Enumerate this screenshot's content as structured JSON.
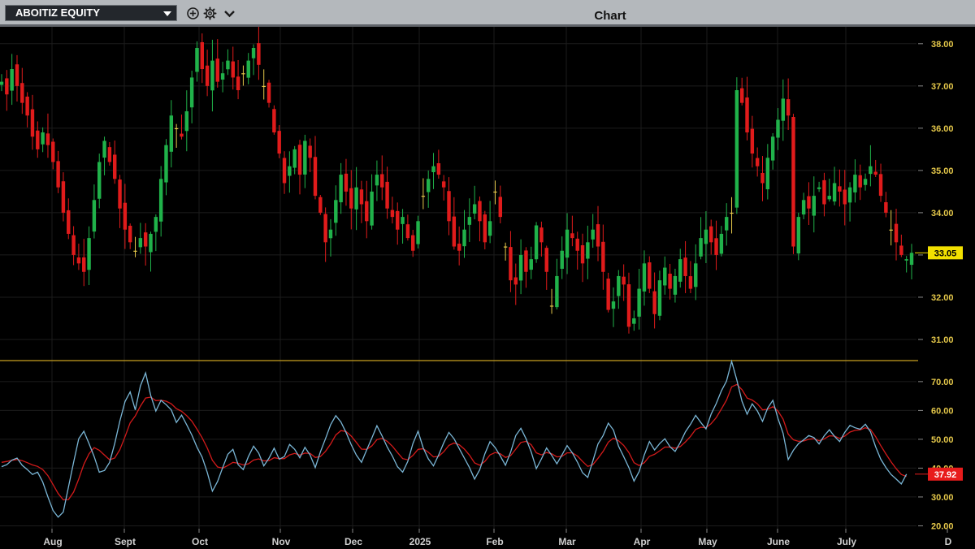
{
  "toolbar": {
    "security": "ABOITIZ EQUITY",
    "title": "Chart"
  },
  "icons": {
    "add": "add-circle-icon",
    "settings": "gear-icon",
    "dropdown": "chevron-down-icon",
    "security_dropdown": "caret-down-icon"
  },
  "colors": {
    "background": "#000000",
    "up_candle": "#20b24a",
    "down_candle": "#e01b1b",
    "doji": "#e5c84a",
    "divider": "#c8a020",
    "rsi_line": "#7ab6d6",
    "rsi_ma_line": "#d21a1a",
    "last_price_tag": "#f2e000",
    "rsi_value_tag": "#e81c1c",
    "axis_text_price": "#e5c84a",
    "axis_text_date": "#cfcfcf",
    "grid": "#1c1c1c"
  },
  "chart_data": [
    {
      "type": "candlestick",
      "title": "",
      "ylim": [
        30.5,
        38.4
      ],
      "y_ticks": [
        "38.00",
        "37.00",
        "36.00",
        "35.00",
        "34.00",
        "33.00",
        "32.00",
        "31.00"
      ],
      "x_labels": [
        "Aug",
        "Sept",
        "Oct",
        "Nov",
        "Dec",
        "2025",
        "Feb",
        "Mar",
        "Apr",
        "May",
        "June",
        "July",
        "D"
      ],
      "last_price": "33.05",
      "grid": true,
      "close": [
        37.1,
        36.8,
        37.4,
        37.0,
        36.6,
        36.3,
        35.8,
        35.5,
        35.9,
        35.6,
        35.2,
        34.6,
        34.0,
        33.5,
        33.0,
        32.8,
        32.6,
        33.4,
        34.3,
        35.2,
        35.7,
        35.2,
        34.8,
        34.1,
        33.6,
        33.3,
        33.1,
        33.4,
        33.2,
        33.5,
        33.9,
        34.8,
        35.6,
        36.3,
        36.0,
        35.8,
        36.4,
        37.2,
        37.9,
        37.4,
        37.0,
        37.6,
        37.1,
        37.3,
        37.6,
        37.2,
        36.9,
        37.3,
        37.6,
        37.9,
        37.5,
        37.0,
        36.6,
        35.9,
        35.4,
        34.7,
        35.1,
        35.5,
        34.9,
        35.7,
        35.3,
        34.4,
        34.0,
        33.3,
        33.6,
        34.3,
        34.9,
        34.5,
        34.1,
        34.6,
        34.2,
        33.8,
        34.5,
        34.9,
        34.6,
        34.1,
        33.9,
        33.6,
        33.9,
        33.4,
        33.1,
        33.8,
        34.4,
        34.8,
        35.1,
        34.9,
        34.6,
        33.8,
        33.2,
        33.1,
        33.6,
        33.9,
        34.2,
        33.8,
        33.3,
        33.8,
        34.5,
        33.9,
        33.2,
        32.4,
        32.3,
        33.0,
        32.6,
        32.9,
        33.7,
        33.3,
        32.6,
        31.8,
        32.5,
        33.1,
        33.6,
        33.4,
        33.1,
        32.8,
        33.3,
        33.6,
        33.2,
        32.6,
        31.7,
        31.9,
        32.5,
        32.3,
        31.3,
        31.5,
        32.2,
        32.8,
        32.2,
        31.6,
        32.4,
        32.7,
        32.2,
        32.5,
        32.9,
        32.5,
        32.2,
        32.8,
        33.4,
        33.6,
        33.3,
        33.0,
        33.5,
        33.9,
        34.0,
        36.9,
        36.6,
        35.9,
        35.4,
        35.1,
        34.7,
        35.3,
        35.8,
        36.2,
        36.7,
        36.3,
        33.2,
        33.9,
        34.3,
        34.1,
        34.4,
        34.6,
        34.2,
        34.4,
        34.7,
        34.5,
        34.2,
        34.6,
        34.9,
        34.6,
        34.8,
        35.1,
        34.9,
        34.4,
        34.0,
        33.6,
        33.3,
        33.0,
        32.9,
        33.05
      ],
      "series": [
        {
          "name": "",
          "type": "rsi",
          "ylim": [
            19,
            77
          ],
          "y_ticks": [
            "70.00",
            "60.00",
            "50.00",
            "40.00",
            "30.00",
            "20.00"
          ],
          "last_value": "37.92",
          "values": [
            40.5,
            41.2,
            42.8,
            43.5,
            41.0,
            39.5,
            37.8,
            38.6,
            35.2,
            30.1,
            25.3,
            23.0,
            24.8,
            33.5,
            42.0,
            50.2,
            52.8,
            48.5,
            44.0,
            38.6,
            39.2,
            42.0,
            48.5,
            56.3,
            63.1,
            66.4,
            60.2,
            68.5,
            73.0,
            65.2,
            59.8,
            63.5,
            62.0,
            60.2,
            55.8,
            58.4,
            55.0,
            51.5,
            47.2,
            43.8,
            38.5,
            32.0,
            35.4,
            40.2,
            44.8,
            46.5,
            41.2,
            39.5,
            44.0,
            47.6,
            45.2,
            40.8,
            43.4,
            46.9,
            43.1,
            44.0,
            48.2,
            46.5,
            43.6,
            47.2,
            44.5,
            40.2,
            45.6,
            50.2,
            55.1,
            58.2,
            56.0,
            52.3,
            48.1,
            44.5,
            42.0,
            46.3,
            50.4,
            54.7,
            51.2,
            47.3,
            44.2,
            40.5,
            38.6,
            42.3,
            48.5,
            52.8,
            47.0,
            43.2,
            40.8,
            44.6,
            48.8,
            52.4,
            50.2,
            46.8,
            43.5,
            40.2,
            36.2,
            39.5,
            45.0,
            49.2,
            47.1,
            44.2,
            41.0,
            45.5,
            51.3,
            53.8,
            50.2,
            45.6,
            39.8,
            43.2,
            47.0,
            44.4,
            41.5,
            44.6,
            47.8,
            45.3,
            42.1,
            38.4,
            36.8,
            42.5,
            48.4,
            51.3,
            55.6,
            53.2,
            47.6,
            44.0,
            40.2,
            35.5,
            38.8,
            44.6,
            49.2,
            46.3,
            48.5,
            50.2,
            47.4,
            45.8,
            48.9,
            52.6,
            55.2,
            58.3,
            55.8,
            53.6,
            58.7,
            62.4,
            66.8,
            70.2,
            77.0,
            70.5,
            63.2,
            58.7,
            62.3,
            59.8,
            56.2,
            60.8,
            63.5,
            57.2,
            52.1,
            43.0,
            46.2,
            48.5,
            49.8,
            51.3,
            50.6,
            48.4,
            51.2,
            53.3,
            51.0,
            49.2,
            52.4,
            54.8,
            54.0,
            53.5,
            55.2,
            52.6,
            47.4,
            43.1,
            40.2,
            37.8,
            36.2,
            34.5,
            37.92
          ]
        },
        {
          "name": "",
          "type": "rsi_moving_average",
          "values": [
            42.0,
            42.3,
            42.7,
            43.0,
            42.6,
            41.9,
            41.1,
            40.6,
            39.5,
            37.4,
            34.3,
            31.2,
            29.0,
            29.1,
            31.7,
            36.2,
            41.3,
            45.0,
            47.1,
            46.2,
            44.5,
            42.9,
            43.5,
            46.4,
            50.9,
            55.7,
            58.1,
            61.5,
            64.3,
            64.6,
            63.4,
            63.5,
            63.2,
            62.3,
            60.6,
            59.7,
            58.2,
            56.3,
            53.5,
            50.5,
            47.0,
            42.7,
            40.4,
            40.0,
            40.9,
            42.0,
            41.7,
            41.1,
            41.5,
            42.8,
            43.2,
            42.5,
            42.6,
            43.6,
            43.3,
            43.3,
            44.6,
            45.1,
            44.5,
            45.2,
            45.1,
            43.7,
            44.0,
            45.8,
            48.4,
            51.5,
            53.0,
            52.7,
            51.1,
            48.9,
            46.6,
            46.5,
            47.7,
            49.9,
            50.3,
            49.3,
            47.6,
            45.4,
            43.3,
            42.9,
            44.4,
            46.5,
            46.7,
            45.5,
            43.9,
            44.1,
            45.7,
            47.9,
            48.7,
            48.1,
            46.6,
            44.5,
            41.8,
            41.0,
            42.3,
            44.6,
            45.4,
            45.0,
            43.7,
            44.3,
            46.6,
            48.9,
            49.3,
            48.1,
            45.3,
            44.6,
            45.4,
            45.0,
            43.9,
            44.1,
            45.3,
            45.3,
            44.2,
            42.3,
            40.6,
            41.2,
            43.4,
            45.8,
            49.0,
            50.4,
            49.5,
            47.9,
            45.4,
            41.9,
            40.9,
            41.9,
            44.1,
            44.8,
            46.0,
            47.3,
            47.3,
            46.9,
            47.5,
            49.1,
            51.0,
            53.4,
            54.2,
            54.0,
            55.4,
            57.5,
            60.5,
            63.6,
            68.2,
            69.0,
            67.2,
            64.3,
            63.6,
            62.3,
            60.2,
            60.4,
            61.3,
            59.8,
            57.0,
            51.8,
            49.8,
            49.3,
            49.4,
            50.0,
            50.2,
            49.5,
            50.1,
            51.2,
            51.1,
            50.3,
            51.1,
            52.5,
            53.1,
            53.3,
            54.0,
            53.4,
            50.9,
            47.8,
            44.9,
            42.2,
            39.8,
            37.8,
            37.1
          ]
        }
      ]
    }
  ]
}
